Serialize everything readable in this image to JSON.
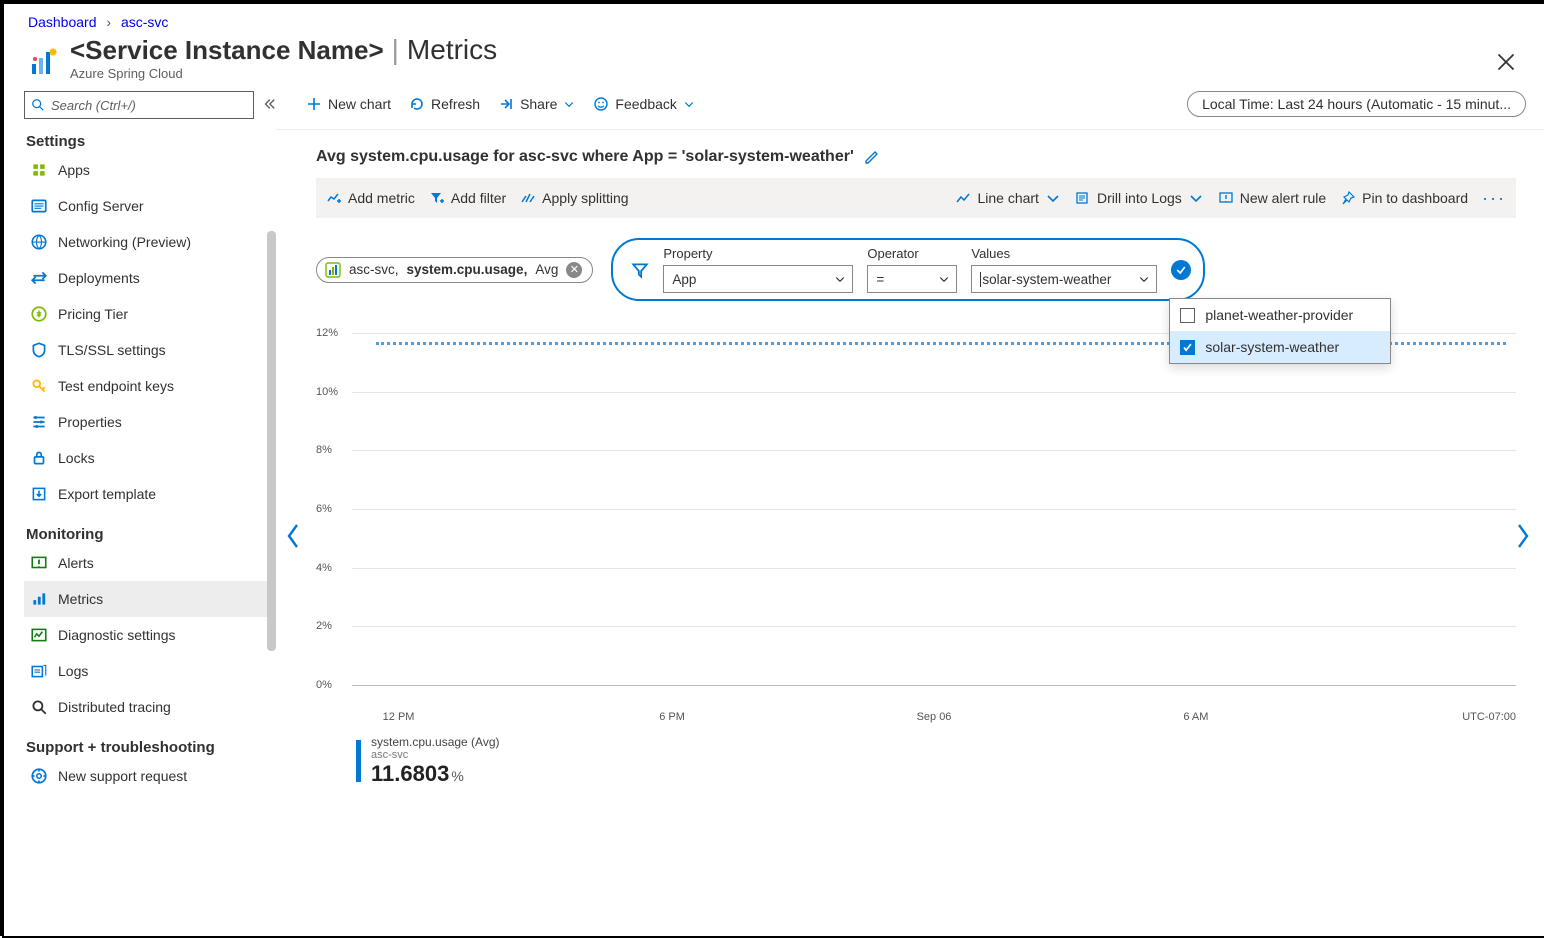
{
  "breadcrumbs": {
    "root": "Dashboard",
    "current": "asc-svc"
  },
  "header": {
    "instance": "<Service Instance Name>",
    "page": "Metrics",
    "subtitle": "Azure Spring Cloud"
  },
  "search": {
    "placeholder": "Search (Ctrl+/)"
  },
  "sidebar": {
    "sections": [
      {
        "title": "Settings",
        "items": [
          {
            "label": "Apps",
            "icon": "apps",
            "color": "#7fba00"
          },
          {
            "label": "Config Server",
            "icon": "config",
            "color": "#0078d4"
          },
          {
            "label": "Networking (Preview)",
            "icon": "network",
            "color": "#0078d4"
          },
          {
            "label": "Deployments",
            "icon": "deploy",
            "color": "#0078d4"
          },
          {
            "label": "Pricing Tier",
            "icon": "pricing",
            "color": "#7fba00"
          },
          {
            "label": "TLS/SSL settings",
            "icon": "shield",
            "color": "#0078d4"
          },
          {
            "label": "Test endpoint keys",
            "icon": "key",
            "color": "#ffb900"
          },
          {
            "label": "Properties",
            "icon": "props",
            "color": "#0078d4"
          },
          {
            "label": "Locks",
            "icon": "lock",
            "color": "#0078d4"
          },
          {
            "label": "Export template",
            "icon": "export",
            "color": "#0078d4"
          }
        ]
      },
      {
        "title": "Monitoring",
        "items": [
          {
            "label": "Alerts",
            "icon": "alert",
            "color": "#107c10"
          },
          {
            "label": "Metrics",
            "icon": "metrics",
            "color": "#0078d4",
            "active": true
          },
          {
            "label": "Diagnostic settings",
            "icon": "diag",
            "color": "#107c10"
          },
          {
            "label": "Logs",
            "icon": "logs",
            "color": "#0078d4"
          },
          {
            "label": "Distributed tracing",
            "icon": "trace",
            "color": "#323130"
          }
        ]
      },
      {
        "title": "Support + troubleshooting",
        "items": [
          {
            "label": "New support request",
            "icon": "support",
            "color": "#0078d4"
          }
        ]
      }
    ]
  },
  "toolbar": {
    "new_chart": "New chart",
    "refresh": "Refresh",
    "share": "Share",
    "feedback": "Feedback",
    "time_range": "Local Time: Last 24 hours (Automatic - 15 minut..."
  },
  "chart": {
    "title": "Avg system.cpu.usage for asc-svc where App = 'solar-system-weather'",
    "chip_resource": "asc-svc,",
    "chip_metric": "system.cpu.usage,",
    "chip_agg": "Avg",
    "actions": {
      "add_metric": "Add metric",
      "add_filter": "Add filter",
      "apply_splitting": "Apply splitting",
      "line_chart": "Line chart",
      "drill_logs": "Drill into Logs",
      "new_alert": "New alert rule",
      "pin": "Pin to dashboard"
    },
    "filter": {
      "property_label": "Property",
      "operator_label": "Operator",
      "values_label": "Values",
      "property": "App",
      "operator": "=",
      "value": "solar-system-weather",
      "options": [
        {
          "label": "planet-weather-provider",
          "checked": false
        },
        {
          "label": "solar-system-weather",
          "checked": true
        }
      ]
    },
    "legend": {
      "metric": "system.cpu.usage (Avg)",
      "resource": "asc-svc",
      "value": "11.6803",
      "unit": "%"
    }
  },
  "chart_data": {
    "type": "line",
    "title": "Avg system.cpu.usage for asc-svc where App = 'solar-system-weather'",
    "xlabel": "",
    "ylabel": "",
    "ylim": [
      0,
      12
    ],
    "y_ticks": [
      "12%",
      "10%",
      "8%",
      "6%",
      "4%",
      "2%",
      "0%"
    ],
    "x_ticks": [
      "12 PM",
      "6 PM",
      "Sep 06",
      "6 AM"
    ],
    "timezone": "UTC-07:00",
    "series": [
      {
        "name": "system.cpu.usage (Avg) — asc-svc",
        "x": [
          "12 PM",
          "6 PM",
          "Sep 06",
          "6 AM"
        ],
        "values": [
          11.68,
          11.68,
          11.68,
          11.68
        ]
      }
    ],
    "summary_value_percent": 11.6803
  }
}
